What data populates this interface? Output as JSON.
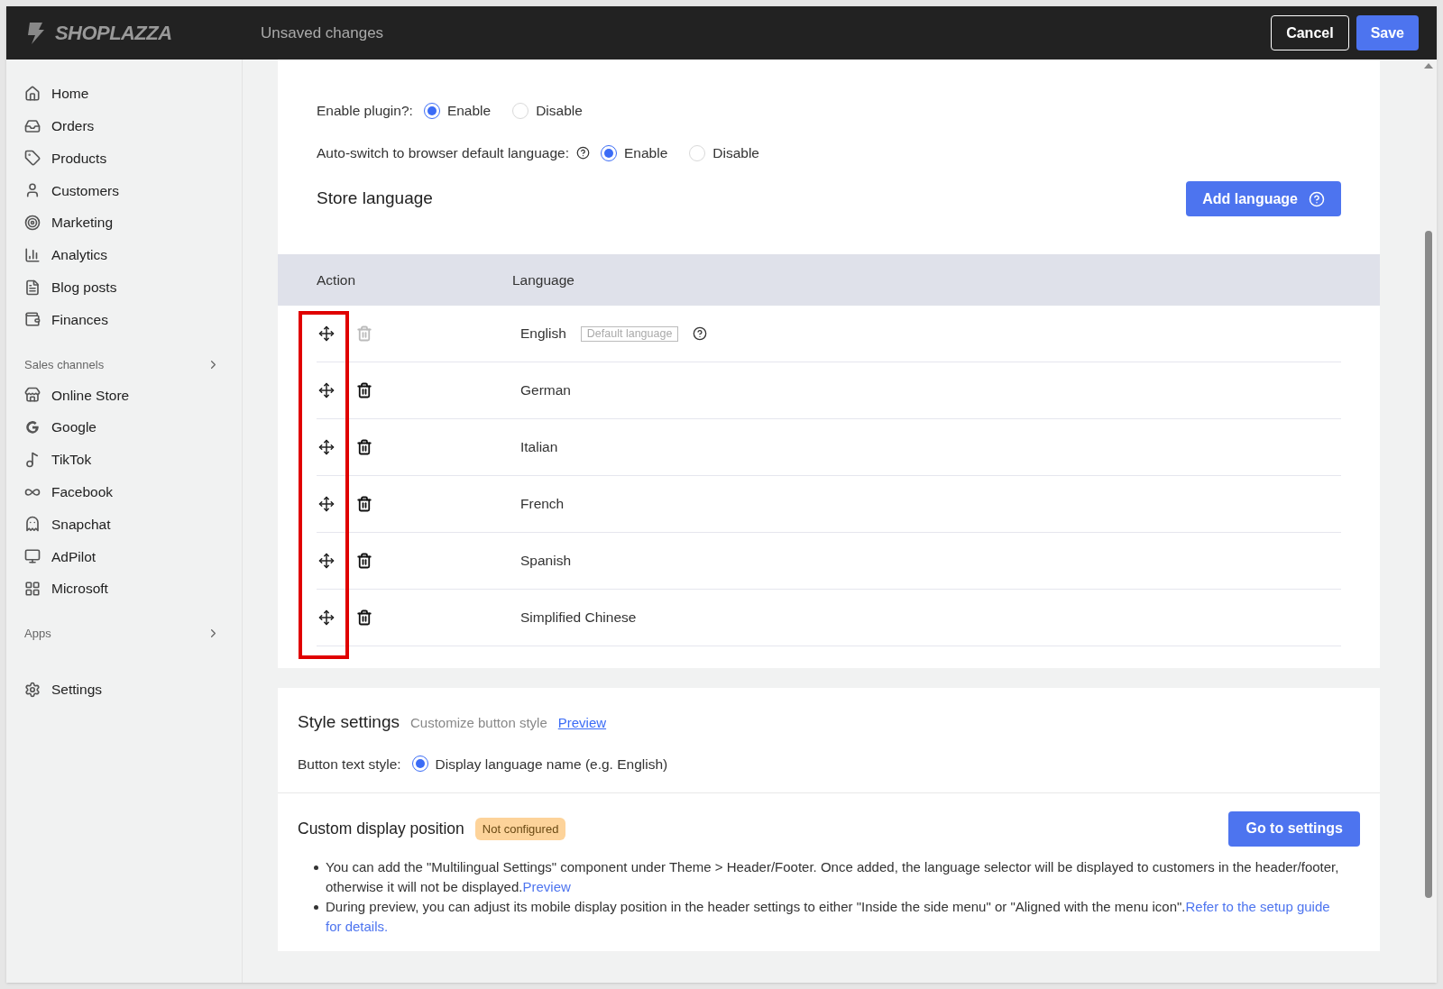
{
  "header": {
    "logo": "SHOPLAZZA",
    "status": "Unsaved changes",
    "buttons": [
      {
        "label": "Cancel",
        "kind": "outline"
      },
      {
        "label": "Save",
        "kind": "primary"
      }
    ]
  },
  "sidebar": {
    "groups": [
      {
        "items": [
          {
            "label": "Home"
          },
          {
            "label": "Orders"
          },
          {
            "label": "Products"
          },
          {
            "label": "Customers"
          },
          {
            "label": "Marketing"
          },
          {
            "label": "Analytics"
          },
          {
            "label": "Blog posts"
          },
          {
            "label": "Finances"
          }
        ]
      },
      {
        "title": "Sales channels",
        "items": [
          {
            "label": "Online Store"
          },
          {
            "label": "Google"
          },
          {
            "label": "TikTok"
          },
          {
            "label": "Facebook"
          },
          {
            "label": "Snapchat"
          },
          {
            "label": "AdPilot"
          },
          {
            "label": "Microsoft"
          }
        ]
      },
      {
        "title": "Apps"
      },
      {
        "items": [
          {
            "label": "Settings"
          }
        ]
      }
    ]
  },
  "plugin_settings": {
    "options": [
      {
        "label": "Enable plugin?:",
        "help": false,
        "choices": [
          {
            "label": "Enable",
            "selected": true
          },
          {
            "label": "Disable",
            "selected": false
          }
        ]
      },
      {
        "label": "Auto-switch to browser default language:",
        "help": true,
        "choices": [
          {
            "label": "Enable",
            "selected": true
          },
          {
            "label": "Disable",
            "selected": false
          }
        ]
      }
    ]
  },
  "store_language": {
    "title": "Store language",
    "add_button": "Add language",
    "columns": [
      "Action",
      "Language"
    ],
    "rows": [
      {
        "language": "English",
        "badge": "Default language",
        "deletable": false
      },
      {
        "language": "German",
        "deletable": true
      },
      {
        "language": "Italian",
        "deletable": true
      },
      {
        "language": "French",
        "deletable": true
      },
      {
        "language": "Spanish",
        "deletable": true
      },
      {
        "language": "Simplified Chinese",
        "deletable": true
      }
    ]
  },
  "style_settings": {
    "title": "Style settings",
    "subtitle": "Customize button style",
    "link": "Preview",
    "option_label": "Button text style:",
    "choices": [
      {
        "label": "Display language name (e.g. English)",
        "selected": true
      }
    ]
  },
  "custom_display": {
    "title": "Custom display position",
    "badge": "Not configured",
    "button": "Go to settings",
    "bullets": [
      {
        "text": "You can add the \"Multilingual Settings\" component under Theme > Header/Footer. Once added, the language selector will be displayed to customers in the header/footer, otherwise it will not be displayed.",
        "link_lines": [
          "Preview"
        ]
      },
      {
        "text": "During preview, you can adjust its mobile display position in the header settings to either \"Inside the side menu\" or \"Aligned with the menu icon\".",
        "link_lines": [
          "Refer to the setup guide",
          "for details."
        ]
      }
    ]
  }
}
